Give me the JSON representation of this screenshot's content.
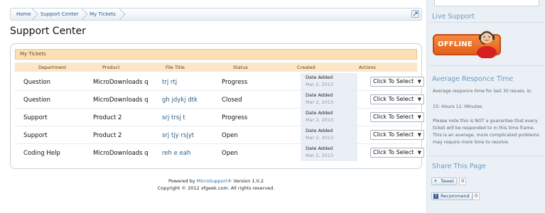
{
  "breadcrumb": [
    "Home",
    "Support Center",
    "My Tickets"
  ],
  "page_title": "Support Center",
  "tickets": {
    "header": "My Tickets",
    "columns": [
      "Department",
      "Product",
      "File Title",
      "Status",
      "Created",
      "Actions"
    ],
    "rows": [
      {
        "department": "Question",
        "product": "MicroDownloads q",
        "title": "trj rtj",
        "status": "Progress",
        "created_label": "Date Added",
        "created_date": "Mar 2, 2013",
        "action": "Click To Select"
      },
      {
        "department": "Question",
        "product": "MicroDownloads q",
        "title": "gh jdykj dtk",
        "status": "Closed",
        "created_label": "Date Added",
        "created_date": "Mar 2, 2013",
        "action": "Click To Select"
      },
      {
        "department": "Support",
        "product": "Product 2",
        "title": "srj trsj t",
        "status": "Progress",
        "created_label": "Date Added",
        "created_date": "Mar 2, 2013",
        "action": "Click To Select"
      },
      {
        "department": "Support",
        "product": "Product 2",
        "title": "srj tjy rsjyt",
        "status": "Open",
        "created_label": "Date Added",
        "created_date": "Mar 2, 2013",
        "action": "Click To Select"
      },
      {
        "department": "Coding Help",
        "product": "MicroDownloads q",
        "title": "reh e eah",
        "status": "Open",
        "created_label": "Date Added",
        "created_date": "Mar 2, 2013",
        "action": "Click To Select"
      }
    ]
  },
  "footer": {
    "powered_prefix": "Powered by ",
    "brand": "MicroSupport®",
    "version": " Version 1.0.2",
    "copyright": "Copyright © 2012 xfgeek.com. All rights reserved."
  },
  "sidebar": {
    "live_support_title": "Live Support",
    "offline_label": "OFFLINE",
    "response_title": "Average Responce Time",
    "response_intro": "Average responce time for last 30 issues, is:",
    "response_value": "15: Hours   11: Minutes",
    "response_note": "Please note this is NOT a guarantee that every ticket will be responded to in this time frame. This is an average, more complicated problems may require more time to resolve.",
    "share_title": "Share This Page",
    "tweet_label": "Tweet",
    "tweet_count": "0",
    "recommend_label": "Recommend",
    "recommend_count": "0"
  },
  "colors": {
    "link": "#2b5f8c",
    "header_bg": "#fbe0b6",
    "sidebar_bg": "#eaf0f6",
    "offline_orange": "#e25f1a"
  }
}
